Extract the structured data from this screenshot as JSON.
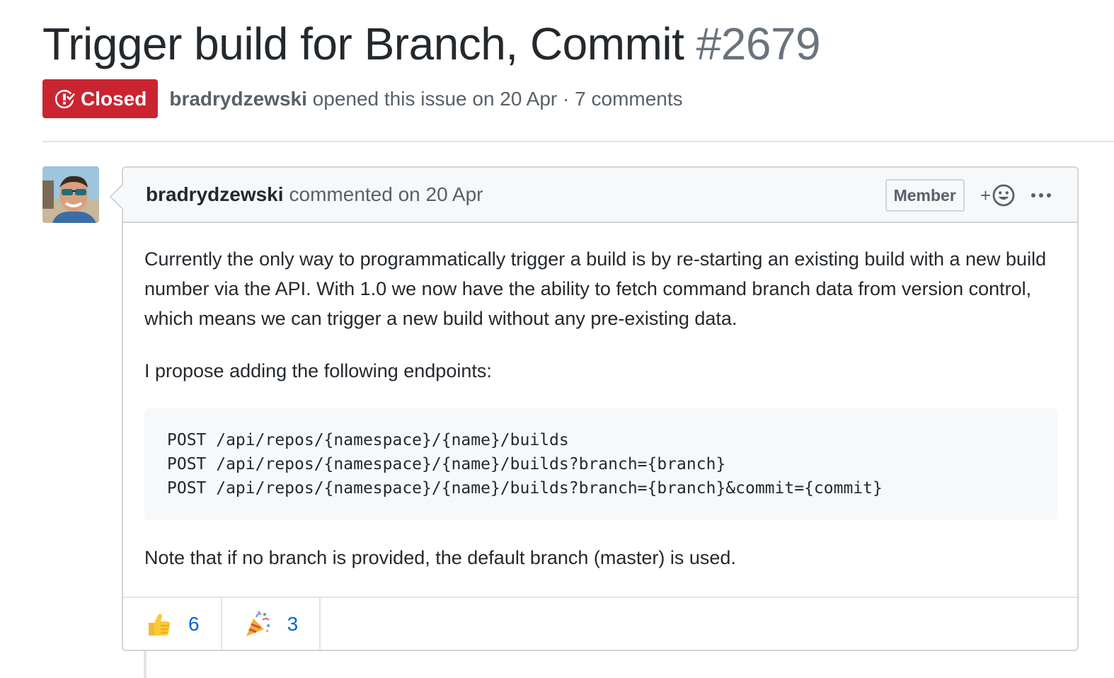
{
  "issue": {
    "title": "Trigger build for Branch, Commit",
    "number": "#2679",
    "state": "Closed",
    "state_color": "#cb2431",
    "author": "bradrydzewski",
    "meta": "opened this issue on 20 Apr · 7 comments"
  },
  "comment": {
    "author": "bradrydzewski",
    "action": "commented on 20 Apr",
    "role_badge": "Member",
    "add_reaction_label": "+",
    "icons": [
      "smiley-icon",
      "kebab-horizontal-icon",
      "issue-closed-icon"
    ],
    "body": {
      "paragraph_1": "Currently the only way to programmatically trigger a build is by re-starting an existing build with a new build number via the API. With 1.0 we now have the ability to fetch command branch data from version control, which means we can trigger a new build without any pre-existing data.",
      "paragraph_2": "I propose adding the following endpoints:",
      "code_lines": [
        "POST /api/repos/{namespace}/{name}/builds",
        "POST /api/repos/{namespace}/{name}/builds?branch={branch}",
        "POST /api/repos/{namespace}/{name}/builds?branch={branch}&commit={commit}"
      ],
      "paragraph_3": "Note that if no branch is provided, the default branch (master) is used."
    },
    "reactions": [
      {
        "icon": "thumbs-up-icon",
        "count": "6"
      },
      {
        "icon": "tada-icon",
        "count": "3"
      }
    ]
  }
}
